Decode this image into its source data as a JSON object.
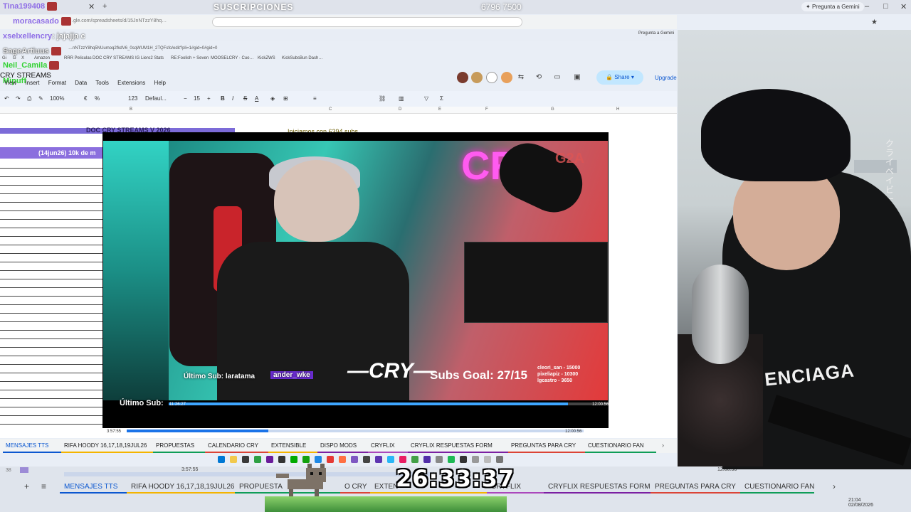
{
  "overlay": {
    "title": "SUSCRIPCIONES",
    "count": "6796  7500",
    "gemini_label": "Pregunta a Gemini"
  },
  "chat": [
    {
      "user": "Tina199408",
      "msg": ""
    },
    {
      "user": "moracasado",
      "msg": ""
    },
    {
      "user": "xselxellencry",
      "msg": ": jajajja c"
    },
    {
      "user": "SageArtiuus",
      "msg": ""
    },
    {
      "user": "Neil_Camila",
      "msg": ""
    },
    {
      "user": "Mipuff",
      "msg": ""
    }
  ],
  "browser": {
    "url": "…gle.com/spreadsheets/d/15JnNTzzY8hq…",
    "url2": "…nNTzzY8hq5NUumoq2fkdV6_0sqWUM1H_2TQFsfo/edit?pli=1#gid=0#gid=0",
    "gemini_small": "Pregunta a Gemini",
    "bookmarks": [
      "Gi",
      "G",
      "X",
      "Amazon",
      "RRR Peliculas",
      "DOC CRY STREAMS",
      "IG Liero2 Stats",
      "RE:Foolish + Seven",
      "MOOSELCRY · Cuo…",
      "KickZWS",
      "KickSubsBun Dash…"
    ]
  },
  "sheets": {
    "doc_title": "CRY STREAMS",
    "menu": [
      "View",
      "Insert",
      "Format",
      "Data",
      "Tools",
      "Extensions",
      "Help"
    ],
    "zoom": "100%",
    "font": "Defaul...",
    "font_size": "15",
    "number_format": "123",
    "share_label": "Share",
    "upgrade_label": "Upgrade",
    "columns": [
      "B",
      "C",
      "D",
      "E",
      "F",
      "G",
      "H"
    ],
    "cell_title": "DOC CRY STREAMS V 2026",
    "cell_date": "(14jun26) 10k de m",
    "cell_iniciamos": "Iniciamos con 6394 subs",
    "cell_fuerza": "#fuerza mods"
  },
  "stream_overlay": {
    "ultimo_sub_label": "Último Sub:",
    "ultimo_sub_value": "laratama",
    "ultimo_sub_label_outer": "Último Sub:",
    "last_sub_user": "ander_wke",
    "logo": "CRY",
    "subs_goal": "Subs Goal: 27/15",
    "donors": [
      "cleori_san - 15000",
      "pixeliapiz - 10300",
      "lgcastro - 3650"
    ],
    "sponsor": "G2A",
    "video_time_left": "11:26:27",
    "video_time_right": "12:00:56",
    "video_progress": 0.91,
    "outer_time_left": "3:57:55",
    "outer_time_right": "12:00:56",
    "outer_progress": 0.31
  },
  "sheet_tabs": [
    {
      "label": "MENSAJES TTS",
      "active": true,
      "color": "#0b57d0"
    },
    {
      "label": "RIFA HOODY 16,17,18,19JUL26",
      "active": false,
      "color": "#f4b400"
    },
    {
      "label": "PROPUESTAS",
      "active": false,
      "color": "#0f9d58"
    },
    {
      "label": "CALENDARIO CRY",
      "active": false,
      "color": "#db4437"
    },
    {
      "label": "EXTENSIBLE",
      "active": false,
      "color": "#f4b400"
    },
    {
      "label": "DISPO MODS",
      "active": false,
      "color": "#7b1fa2"
    },
    {
      "label": "CRYFLIX",
      "active": false,
      "color": "#ab47bc"
    },
    {
      "label": "CRYFLIX RESPUESTAS FORM",
      "active": false,
      "color": "#7b1fa2"
    },
    {
      "label": "PREGUNTAS PARA CRY",
      "active": false,
      "color": "#db4437"
    },
    {
      "label": "CUESTIONARIO FAN",
      "active": false,
      "color": "#0f9d58"
    }
  ],
  "bottom": {
    "timer": "26:33:37",
    "row_number": "38",
    "time_left": "3:57:55",
    "time_right": "12:00:56",
    "tabs": [
      "MENSAJES TTS",
      "RIFA HOODY 16,17,18,19JUL26",
      "PROPUESTA",
      "O CRY",
      "EXTEN",
      "CRYFLIX",
      "CRYFLIX RESPUESTAS FORM",
      "PREGUNTAS PARA CRY",
      "CUESTIONARIO FAN"
    ],
    "tray_time": "21:04",
    "tray_date": "02/08/2026"
  },
  "webcam": {
    "hoodie_text": "ENCIAGA",
    "sign_text": "クライベイビー"
  }
}
